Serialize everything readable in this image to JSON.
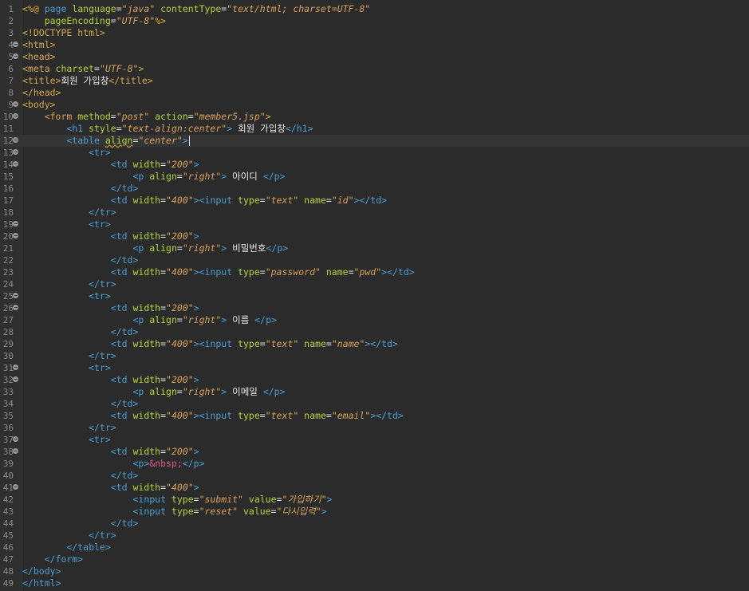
{
  "editor": {
    "current_line": 12,
    "lines": [
      {
        "n": "1",
        "fold": false,
        "segs": [
          {
            "t": "<%@",
            "c": "t-dir"
          },
          {
            "t": " page ",
            "c": "t-tag2"
          },
          {
            "t": "language",
            "c": "t-attr"
          },
          {
            "t": "=",
            "c": "t-text"
          },
          {
            "t": "\"java\"",
            "c": "t-str"
          },
          {
            "t": " contentType",
            "c": "t-attr"
          },
          {
            "t": "=",
            "c": "t-text"
          },
          {
            "t": "\"text/html; charset=UTF-8\"",
            "c": "t-str"
          }
        ]
      },
      {
        "n": "2",
        "fold": false,
        "segs": [
          {
            "t": "    pageEncoding",
            "c": "t-attr"
          },
          {
            "t": "=",
            "c": "t-text"
          },
          {
            "t": "\"UTF-8\"",
            "c": "t-str"
          },
          {
            "t": "%>",
            "c": "t-dir"
          }
        ]
      },
      {
        "n": "3",
        "fold": false,
        "segs": [
          {
            "t": "<!DOCTYPE html>",
            "c": "t-tag"
          }
        ]
      },
      {
        "n": "4",
        "fold": true,
        "segs": [
          {
            "t": "<html>",
            "c": "t-tag"
          }
        ]
      },
      {
        "n": "5",
        "fold": true,
        "segs": [
          {
            "t": "<head>",
            "c": "t-tag"
          }
        ]
      },
      {
        "n": "6",
        "fold": false,
        "segs": [
          {
            "t": "<meta ",
            "c": "t-tag"
          },
          {
            "t": "charset",
            "c": "t-attr"
          },
          {
            "t": "=",
            "c": "t-text"
          },
          {
            "t": "\"UTF-8\"",
            "c": "t-str"
          },
          {
            "t": ">",
            "c": "t-tag"
          }
        ]
      },
      {
        "n": "7",
        "fold": false,
        "segs": [
          {
            "t": "<title>",
            "c": "t-tag"
          },
          {
            "t": "회원 가입창",
            "c": "t-text"
          },
          {
            "t": "</title>",
            "c": "t-tag"
          }
        ]
      },
      {
        "n": "8",
        "fold": false,
        "segs": [
          {
            "t": "</head>",
            "c": "t-tag"
          }
        ]
      },
      {
        "n": "9",
        "fold": true,
        "segs": [
          {
            "t": "<body>",
            "c": "t-tag"
          }
        ]
      },
      {
        "n": "10",
        "fold": true,
        "segs": [
          {
            "t": "    <form ",
            "c": "t-tag"
          },
          {
            "t": "method",
            "c": "t-attr"
          },
          {
            "t": "=",
            "c": "t-text"
          },
          {
            "t": "\"post\"",
            "c": "t-str"
          },
          {
            "t": " action",
            "c": "t-attr"
          },
          {
            "t": "=",
            "c": "t-text"
          },
          {
            "t": "\"member5.jsp\"",
            "c": "t-str"
          },
          {
            "t": ">",
            "c": "t-tag"
          }
        ]
      },
      {
        "n": "11",
        "fold": false,
        "segs": [
          {
            "t": "        <h1 ",
            "c": "t-tag2"
          },
          {
            "t": "style",
            "c": "t-attr"
          },
          {
            "t": "=",
            "c": "t-text"
          },
          {
            "t": "\"text-align:center\"",
            "c": "t-str"
          },
          {
            "t": "> ",
            "c": "t-tag2"
          },
          {
            "t": "회원 가입창",
            "c": "t-text"
          },
          {
            "t": "</h1>",
            "c": "t-tag2"
          }
        ]
      },
      {
        "n": "12",
        "fold": true,
        "caret": true,
        "segs": [
          {
            "t": "        <table ",
            "c": "t-tag2"
          },
          {
            "t": "align",
            "c": "t-attr t-err"
          },
          {
            "t": "=",
            "c": "t-text"
          },
          {
            "t": "\"center\"",
            "c": "t-str"
          },
          {
            "t": ">",
            "c": "t-tag2"
          }
        ]
      },
      {
        "n": "13",
        "fold": true,
        "segs": [
          {
            "t": "            <tr>",
            "c": "t-tag2"
          }
        ]
      },
      {
        "n": "14",
        "fold": true,
        "segs": [
          {
            "t": "                <td ",
            "c": "t-tag2"
          },
          {
            "t": "width",
            "c": "t-attr"
          },
          {
            "t": "=",
            "c": "t-text"
          },
          {
            "t": "\"200\"",
            "c": "t-str"
          },
          {
            "t": ">",
            "c": "t-tag2"
          }
        ]
      },
      {
        "n": "15",
        "fold": false,
        "segs": [
          {
            "t": "                    <p ",
            "c": "t-tag2"
          },
          {
            "t": "align",
            "c": "t-attr"
          },
          {
            "t": "=",
            "c": "t-text"
          },
          {
            "t": "\"right\"",
            "c": "t-str"
          },
          {
            "t": "> ",
            "c": "t-tag2"
          },
          {
            "t": "아이디 ",
            "c": "t-text"
          },
          {
            "t": "</p>",
            "c": "t-tag2"
          }
        ]
      },
      {
        "n": "16",
        "fold": false,
        "segs": [
          {
            "t": "                </td>",
            "c": "t-tag2"
          }
        ]
      },
      {
        "n": "17",
        "fold": false,
        "segs": [
          {
            "t": "                <td ",
            "c": "t-tag2"
          },
          {
            "t": "width",
            "c": "t-attr"
          },
          {
            "t": "=",
            "c": "t-text"
          },
          {
            "t": "\"400\"",
            "c": "t-str"
          },
          {
            "t": "><input ",
            "c": "t-tag2"
          },
          {
            "t": "type",
            "c": "t-attr"
          },
          {
            "t": "=",
            "c": "t-text"
          },
          {
            "t": "\"text\"",
            "c": "t-str"
          },
          {
            "t": " name",
            "c": "t-attr"
          },
          {
            "t": "=",
            "c": "t-text"
          },
          {
            "t": "\"id\"",
            "c": "t-str"
          },
          {
            "t": "></td>",
            "c": "t-tag2"
          }
        ]
      },
      {
        "n": "18",
        "fold": false,
        "segs": [
          {
            "t": "            </tr>",
            "c": "t-tag2"
          }
        ]
      },
      {
        "n": "19",
        "fold": true,
        "segs": [
          {
            "t": "            <tr>",
            "c": "t-tag2"
          }
        ]
      },
      {
        "n": "20",
        "fold": true,
        "segs": [
          {
            "t": "                <td ",
            "c": "t-tag2"
          },
          {
            "t": "width",
            "c": "t-attr"
          },
          {
            "t": "=",
            "c": "t-text"
          },
          {
            "t": "\"200\"",
            "c": "t-str"
          },
          {
            "t": ">",
            "c": "t-tag2"
          }
        ]
      },
      {
        "n": "21",
        "fold": false,
        "segs": [
          {
            "t": "                    <p ",
            "c": "t-tag2"
          },
          {
            "t": "align",
            "c": "t-attr"
          },
          {
            "t": "=",
            "c": "t-text"
          },
          {
            "t": "\"right\"",
            "c": "t-str"
          },
          {
            "t": "> ",
            "c": "t-tag2"
          },
          {
            "t": "비밀번호",
            "c": "t-text"
          },
          {
            "t": "</p>",
            "c": "t-tag2"
          }
        ]
      },
      {
        "n": "22",
        "fold": false,
        "segs": [
          {
            "t": "                </td>",
            "c": "t-tag2"
          }
        ]
      },
      {
        "n": "23",
        "fold": false,
        "segs": [
          {
            "t": "                <td ",
            "c": "t-tag2"
          },
          {
            "t": "width",
            "c": "t-attr"
          },
          {
            "t": "=",
            "c": "t-text"
          },
          {
            "t": "\"400\"",
            "c": "t-str"
          },
          {
            "t": "><input ",
            "c": "t-tag2"
          },
          {
            "t": "type",
            "c": "t-attr"
          },
          {
            "t": "=",
            "c": "t-text"
          },
          {
            "t": "\"password\"",
            "c": "t-str"
          },
          {
            "t": " name",
            "c": "t-attr"
          },
          {
            "t": "=",
            "c": "t-text"
          },
          {
            "t": "\"pwd\"",
            "c": "t-str"
          },
          {
            "t": "></td>",
            "c": "t-tag2"
          }
        ]
      },
      {
        "n": "24",
        "fold": false,
        "segs": [
          {
            "t": "            </tr>",
            "c": "t-tag2"
          }
        ]
      },
      {
        "n": "25",
        "fold": true,
        "segs": [
          {
            "t": "            <tr>",
            "c": "t-tag2"
          }
        ]
      },
      {
        "n": "26",
        "fold": true,
        "segs": [
          {
            "t": "                <td ",
            "c": "t-tag2"
          },
          {
            "t": "width",
            "c": "t-attr"
          },
          {
            "t": "=",
            "c": "t-text"
          },
          {
            "t": "\"200\"",
            "c": "t-str"
          },
          {
            "t": ">",
            "c": "t-tag2"
          }
        ]
      },
      {
        "n": "27",
        "fold": false,
        "segs": [
          {
            "t": "                    <p ",
            "c": "t-tag2"
          },
          {
            "t": "align",
            "c": "t-attr"
          },
          {
            "t": "=",
            "c": "t-text"
          },
          {
            "t": "\"right\"",
            "c": "t-str"
          },
          {
            "t": "> ",
            "c": "t-tag2"
          },
          {
            "t": "이름 ",
            "c": "t-text"
          },
          {
            "t": "</p>",
            "c": "t-tag2"
          }
        ]
      },
      {
        "n": "28",
        "fold": false,
        "segs": [
          {
            "t": "                </td>",
            "c": "t-tag2"
          }
        ]
      },
      {
        "n": "29",
        "fold": false,
        "segs": [
          {
            "t": "                <td ",
            "c": "t-tag2"
          },
          {
            "t": "width",
            "c": "t-attr"
          },
          {
            "t": "=",
            "c": "t-text"
          },
          {
            "t": "\"400\"",
            "c": "t-str"
          },
          {
            "t": "><input ",
            "c": "t-tag2"
          },
          {
            "t": "type",
            "c": "t-attr"
          },
          {
            "t": "=",
            "c": "t-text"
          },
          {
            "t": "\"text\"",
            "c": "t-str"
          },
          {
            "t": " name",
            "c": "t-attr"
          },
          {
            "t": "=",
            "c": "t-text"
          },
          {
            "t": "\"name\"",
            "c": "t-str"
          },
          {
            "t": "></td>",
            "c": "t-tag2"
          }
        ]
      },
      {
        "n": "30",
        "fold": false,
        "segs": [
          {
            "t": "            </tr>",
            "c": "t-tag2"
          }
        ]
      },
      {
        "n": "31",
        "fold": true,
        "segs": [
          {
            "t": "            <tr>",
            "c": "t-tag2"
          }
        ]
      },
      {
        "n": "32",
        "fold": true,
        "segs": [
          {
            "t": "                <td ",
            "c": "t-tag2"
          },
          {
            "t": "width",
            "c": "t-attr"
          },
          {
            "t": "=",
            "c": "t-text"
          },
          {
            "t": "\"200\"",
            "c": "t-str"
          },
          {
            "t": ">",
            "c": "t-tag2"
          }
        ]
      },
      {
        "n": "33",
        "fold": false,
        "segs": [
          {
            "t": "                    <p ",
            "c": "t-tag2"
          },
          {
            "t": "align",
            "c": "t-attr"
          },
          {
            "t": "=",
            "c": "t-text"
          },
          {
            "t": "\"right\"",
            "c": "t-str"
          },
          {
            "t": "> ",
            "c": "t-tag2"
          },
          {
            "t": "이메일 ",
            "c": "t-text"
          },
          {
            "t": "</p>",
            "c": "t-tag2"
          }
        ]
      },
      {
        "n": "34",
        "fold": false,
        "segs": [
          {
            "t": "                </td>",
            "c": "t-tag2"
          }
        ]
      },
      {
        "n": "35",
        "fold": false,
        "segs": [
          {
            "t": "                <td ",
            "c": "t-tag2"
          },
          {
            "t": "width",
            "c": "t-attr"
          },
          {
            "t": "=",
            "c": "t-text"
          },
          {
            "t": "\"400\"",
            "c": "t-str"
          },
          {
            "t": "><input ",
            "c": "t-tag2"
          },
          {
            "t": "type",
            "c": "t-attr"
          },
          {
            "t": "=",
            "c": "t-text"
          },
          {
            "t": "\"text\"",
            "c": "t-str"
          },
          {
            "t": " name",
            "c": "t-attr"
          },
          {
            "t": "=",
            "c": "t-text"
          },
          {
            "t": "\"email\"",
            "c": "t-str"
          },
          {
            "t": "></td>",
            "c": "t-tag2"
          }
        ]
      },
      {
        "n": "36",
        "fold": false,
        "segs": [
          {
            "t": "            </tr>",
            "c": "t-tag2"
          }
        ]
      },
      {
        "n": "37",
        "fold": true,
        "segs": [
          {
            "t": "            <tr>",
            "c": "t-tag2"
          }
        ]
      },
      {
        "n": "38",
        "fold": true,
        "segs": [
          {
            "t": "                <td ",
            "c": "t-tag2"
          },
          {
            "t": "width",
            "c": "t-attr"
          },
          {
            "t": "=",
            "c": "t-text"
          },
          {
            "t": "\"200\"",
            "c": "t-str"
          },
          {
            "t": ">",
            "c": "t-tag2"
          }
        ]
      },
      {
        "n": "39",
        "fold": false,
        "segs": [
          {
            "t": "                    <p>",
            "c": "t-tag2"
          },
          {
            "t": "&nbsp;",
            "c": "t-ent"
          },
          {
            "t": "</p>",
            "c": "t-tag2"
          }
        ]
      },
      {
        "n": "40",
        "fold": false,
        "segs": [
          {
            "t": "                </td>",
            "c": "t-tag2"
          }
        ]
      },
      {
        "n": "41",
        "fold": true,
        "segs": [
          {
            "t": "                <td ",
            "c": "t-tag2"
          },
          {
            "t": "width",
            "c": "t-attr"
          },
          {
            "t": "=",
            "c": "t-text"
          },
          {
            "t": "\"400\"",
            "c": "t-str"
          },
          {
            "t": ">",
            "c": "t-tag2"
          }
        ]
      },
      {
        "n": "42",
        "fold": false,
        "segs": [
          {
            "t": "                    <input ",
            "c": "t-tag2"
          },
          {
            "t": "type",
            "c": "t-attr"
          },
          {
            "t": "=",
            "c": "t-text"
          },
          {
            "t": "\"submit\"",
            "c": "t-str"
          },
          {
            "t": " value",
            "c": "t-attr"
          },
          {
            "t": "=",
            "c": "t-text"
          },
          {
            "t": "\"가입하기\"",
            "c": "t-str"
          },
          {
            "t": ">",
            "c": "t-tag2"
          }
        ]
      },
      {
        "n": "43",
        "fold": false,
        "segs": [
          {
            "t": "                    <input ",
            "c": "t-tag2"
          },
          {
            "t": "type",
            "c": "t-attr"
          },
          {
            "t": "=",
            "c": "t-text"
          },
          {
            "t": "\"reset\"",
            "c": "t-str"
          },
          {
            "t": " value",
            "c": "t-attr"
          },
          {
            "t": "=",
            "c": "t-text"
          },
          {
            "t": "\"다시입력\"",
            "c": "t-str"
          },
          {
            "t": ">",
            "c": "t-tag2"
          }
        ]
      },
      {
        "n": "44",
        "fold": false,
        "segs": [
          {
            "t": "                </td>",
            "c": "t-tag2"
          }
        ]
      },
      {
        "n": "45",
        "fold": false,
        "segs": [
          {
            "t": "            </tr>",
            "c": "t-tag2"
          }
        ]
      },
      {
        "n": "46",
        "fold": false,
        "segs": [
          {
            "t": "        </table>",
            "c": "t-tag2"
          }
        ]
      },
      {
        "n": "47",
        "fold": false,
        "segs": [
          {
            "t": "    </form>",
            "c": "t-tag2"
          }
        ]
      },
      {
        "n": "48",
        "fold": false,
        "segs": [
          {
            "t": "</body>",
            "c": "t-tag2"
          }
        ]
      },
      {
        "n": "49",
        "fold": false,
        "segs": [
          {
            "t": "</html>",
            "c": "t-tag2"
          }
        ]
      }
    ]
  }
}
